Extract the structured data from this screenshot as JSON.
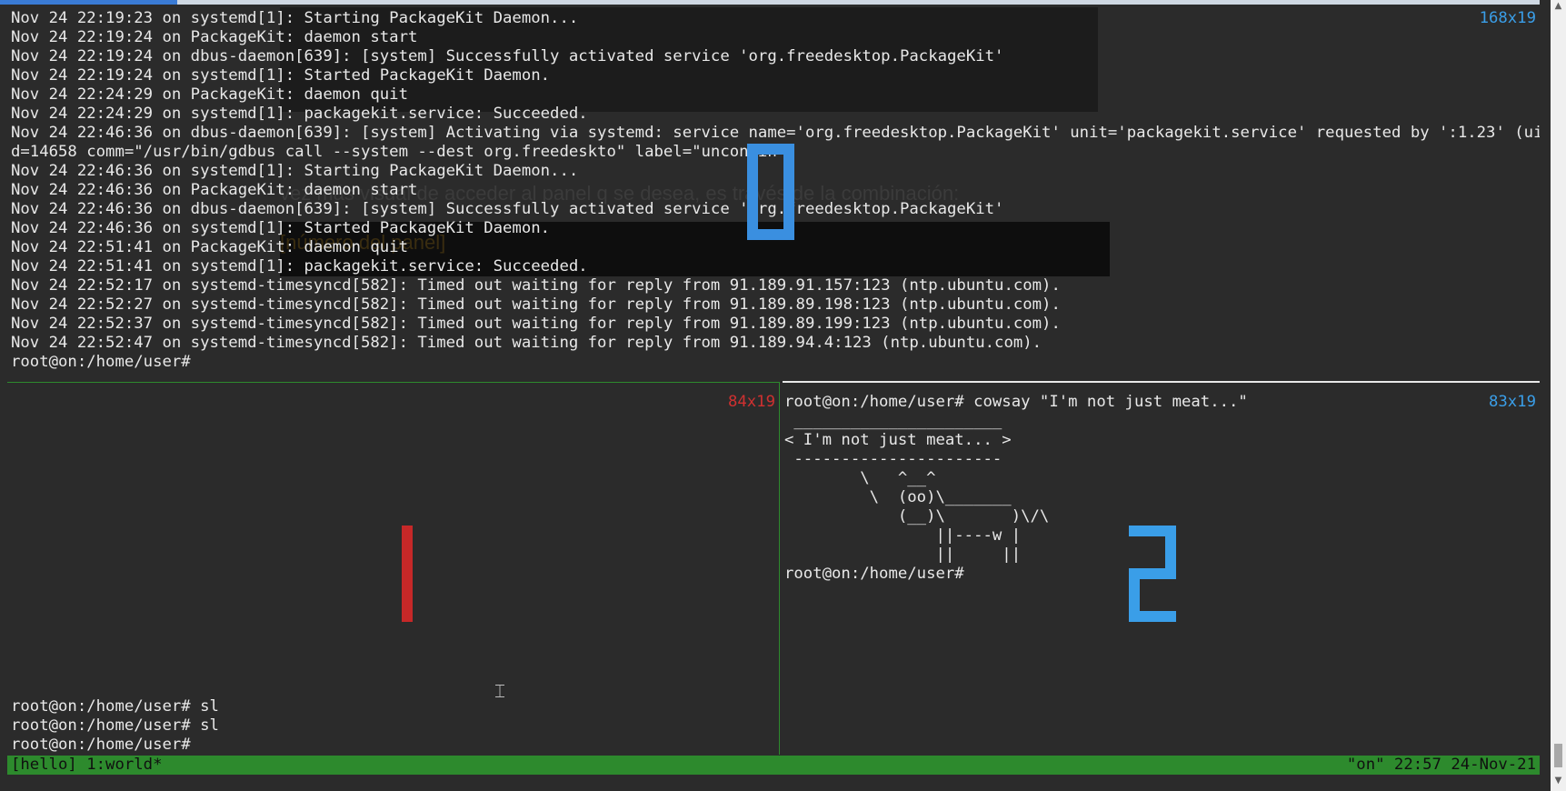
{
  "top_pane": {
    "dims": "168x19",
    "lines": [
      "Nov 24 22:19:23 on systemd[1]: Starting PackageKit Daemon...",
      "Nov 24 22:19:24 on PackageKit: daemon start",
      "Nov 24 22:19:24 on dbus-daemon[639]: [system] Successfully activated service 'org.freedesktop.PackageKit'",
      "Nov 24 22:19:24 on systemd[1]: Started PackageKit Daemon.",
      "Nov 24 22:24:29 on PackageKit: daemon quit",
      "Nov 24 22:24:29 on systemd[1]: packagekit.service: Succeeded.",
      "Nov 24 22:46:36 on dbus-daemon[639]: [system] Activating via systemd: service name='org.freedesktop.PackageKit' unit='packagekit.service' requested by ':1.23' (uid=0 pi",
      "d=14658 comm=\"/usr/bin/gdbus call --system --dest org.freedeskto\" label=\"unconfin",
      "Nov 24 22:46:36 on systemd[1]: Starting PackageKit Daemon...",
      "Nov 24 22:46:36 on PackageKit: daemon start",
      "Nov 24 22:46:36 on dbus-daemon[639]: [system] Successfully activated service 'org.freedesktop.PackageKit'",
      "Nov 24 22:46:36 on systemd[1]: Started PackageKit Daemon.",
      "Nov 24 22:51:41 on PackageKit: daemon quit",
      "Nov 24 22:51:41 on systemd[1]: packagekit.service: Succeeded.",
      "Nov 24 22:52:17 on systemd-timesyncd[582]: Timed out waiting for reply from 91.189.91.157:123 (ntp.ubuntu.com).",
      "Nov 24 22:52:27 on systemd-timesyncd[582]: Timed out waiting for reply from 91.189.89.198:123 (ntp.ubuntu.com).",
      "Nov 24 22:52:37 on systemd-timesyncd[582]: Timed out waiting for reply from 91.189.89.199:123 (ntp.ubuntu.com).",
      "Nov 24 22:52:47 on systemd-timesyncd[582]: Timed out waiting for reply from 91.189.94.4:123 (ntp.ubuntu.com).",
      "root@on:/home/user#"
    ],
    "ghost_text": "vez más visual de acceder al panel q se desea, es través de la combinación:",
    "ghost_text_2": "[número del panel]",
    "pane_number": "0"
  },
  "bottom_left_pane": {
    "dims": "84x19",
    "lines": [
      "root@on:/home/user# sl",
      "root@on:/home/user# sl",
      "root@on:/home/user#"
    ],
    "pane_number": "1"
  },
  "bottom_right_pane": {
    "dims": "83x19",
    "lines": [
      "root@on:/home/user# cowsay \"I'm not just meat...\"",
      " ______________________",
      "< I'm not just meat... >",
      " ----------------------",
      "        \\   ^__^",
      "         \\  (oo)\\_______",
      "            (__)\\       )\\/\\",
      "                ||----w |",
      "                ||     ||",
      "root@on:/home/user#"
    ],
    "pane_number": "2"
  },
  "status_bar": {
    "left": "[hello] 1:world*",
    "right": "\"on\" 22:57 24-Nov-21"
  },
  "colors": {
    "background": "#2b2b2b",
    "status_green": "#2d8a2d",
    "pane_number_active": "#3a9ee8",
    "pane_number_inactive": "#d03030",
    "dims_blue": "#3a9ee8",
    "dims_red": "#d03030"
  },
  "icons": {
    "text_cursor": "ibeam-cursor-icon",
    "scroll_up": "scroll-up-arrow-icon",
    "scroll_down": "scroll-down-arrow-icon"
  }
}
